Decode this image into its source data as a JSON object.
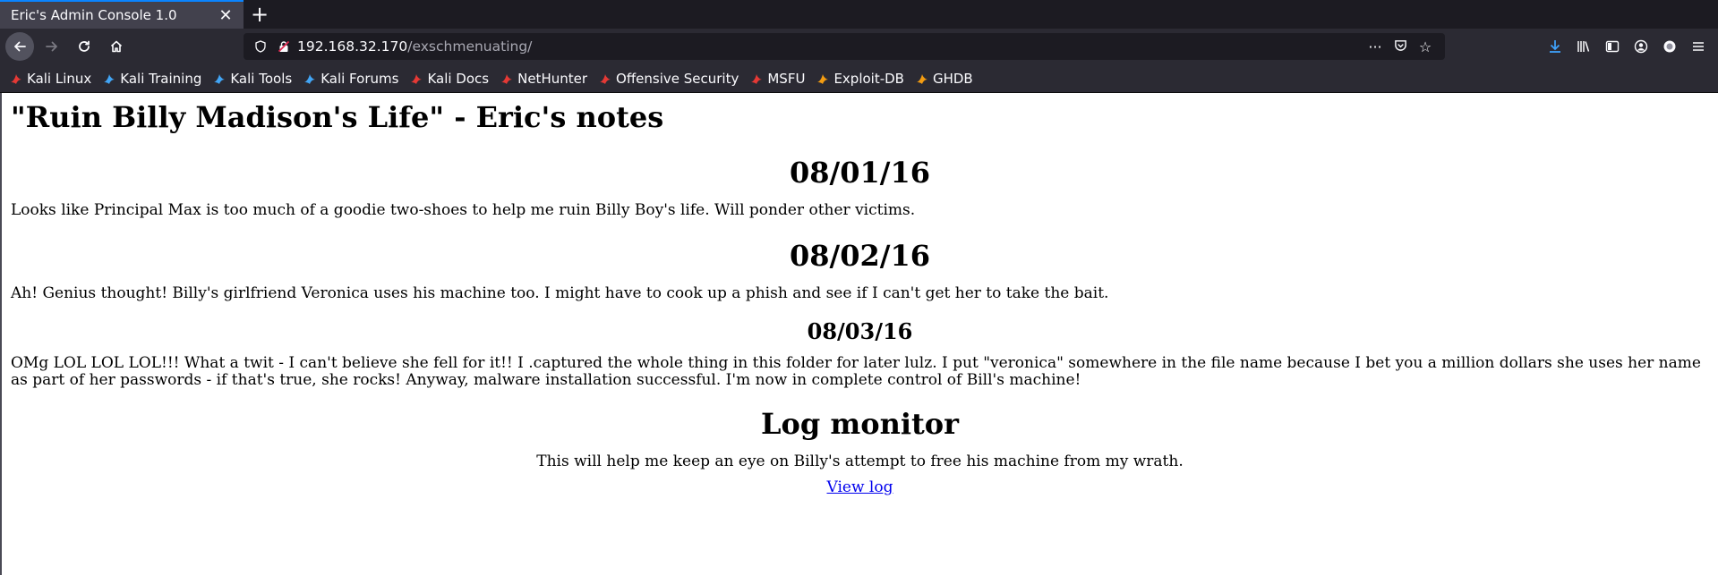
{
  "browser": {
    "tab_title": "Eric's Admin Console 1.0",
    "url_host": "192.168.32.170",
    "url_path": "/exschmenuating/",
    "url_more": "···"
  },
  "bookmarks": [
    {
      "label": "Kali Linux",
      "icon": "kali-dragon-icon",
      "color": "#e53935"
    },
    {
      "label": "Kali Training",
      "icon": "kali-training-icon",
      "color": "#42a5f5"
    },
    {
      "label": "Kali Tools",
      "icon": "kali-tools-icon",
      "color": "#42a5f5"
    },
    {
      "label": "Kali Forums",
      "icon": "kali-forums-icon",
      "color": "#42a5f5"
    },
    {
      "label": "Kali Docs",
      "icon": "kali-docs-icon",
      "color": "#e53935"
    },
    {
      "label": "NetHunter",
      "icon": "nethunter-icon",
      "color": "#e53935"
    },
    {
      "label": "Offensive Security",
      "icon": "offsec-icon",
      "color": "#e53935"
    },
    {
      "label": "MSFU",
      "icon": "msfu-icon",
      "color": "#e53935"
    },
    {
      "label": "Exploit-DB",
      "icon": "exploitdb-icon",
      "color": "#f39c12"
    },
    {
      "label": "GHDB",
      "icon": "ghdb-icon",
      "color": "#f39c12"
    }
  ],
  "page": {
    "heading": "\"Ruin Billy Madison's Life\" - Eric's notes",
    "entries": [
      {
        "date": "08/01/16",
        "text": "Looks like Principal Max is too much of a goodie two-shoes to help me ruin Billy Boy's life. Will ponder other victims."
      },
      {
        "date": "08/02/16",
        "text": "Ah! Genius thought! Billy's girlfriend Veronica uses his machine too. I might have to cook up a phish and see if I can't get her to take the bait."
      },
      {
        "date": "08/03/16",
        "text": "OMg LOL LOL LOL!!! What a twit - I can't believe she fell for it!! I .captured the whole thing in this folder for later lulz. I put \"veronica\" somewhere in the file name because I bet you a million dollars she uses her name as part of her passwords - if that's true, she rocks! Anyway, malware installation successful. I'm now in complete control of Bill's machine!"
      }
    ],
    "log_heading": "Log monitor",
    "log_text": "This will help me keep an eye on Billy's attempt to free his machine from my wrath.",
    "log_link": "View log"
  }
}
